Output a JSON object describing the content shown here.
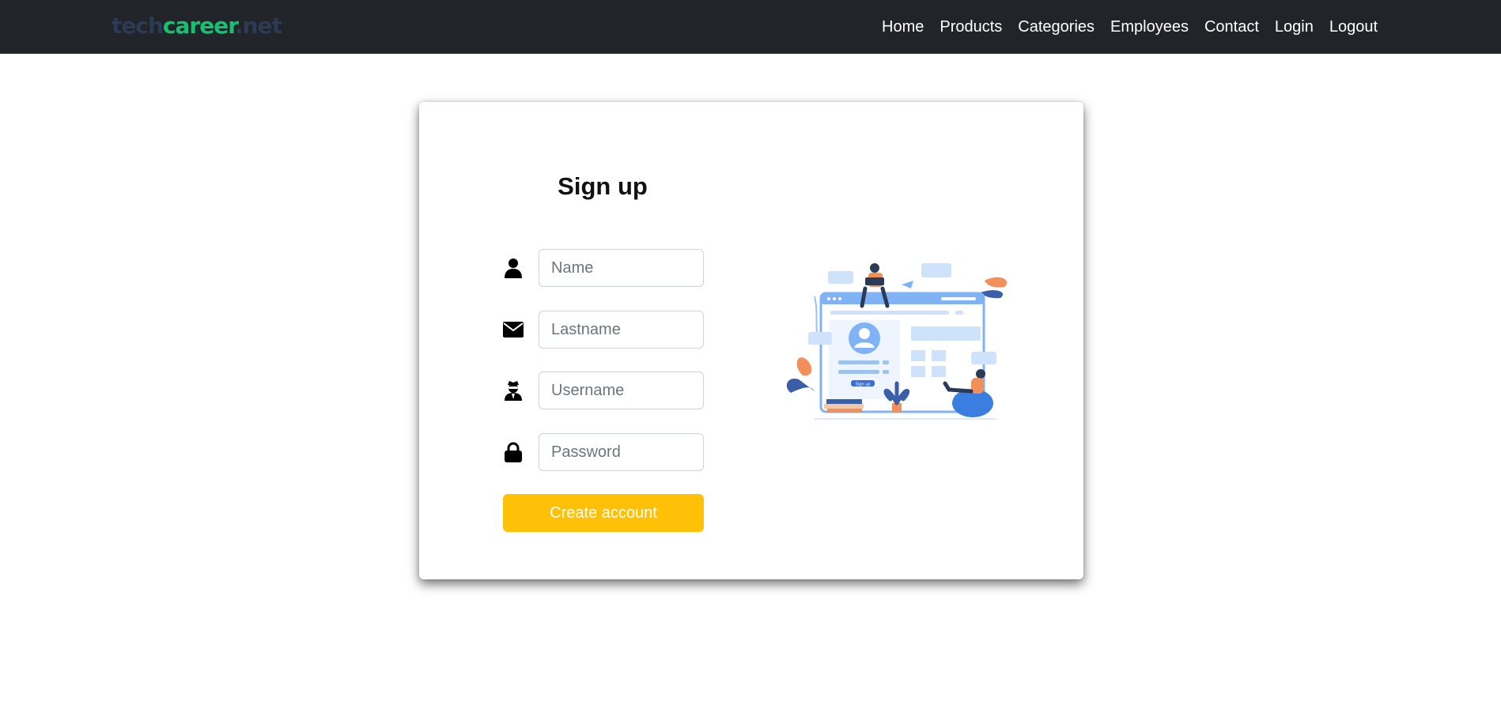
{
  "brand": {
    "part1": "tech",
    "part2": "career",
    "part3": ".net"
  },
  "nav": [
    "Home",
    "Products",
    "Categories",
    "Employees",
    "Contact",
    "Login",
    "Logout"
  ],
  "form": {
    "title": "Sign up",
    "fields": [
      {
        "icon": "person-icon",
        "placeholder": "Name",
        "value": ""
      },
      {
        "icon": "envelope-icon",
        "placeholder": "Lastname",
        "value": ""
      },
      {
        "icon": "user-secret-icon",
        "placeholder": "Username",
        "value": ""
      },
      {
        "icon": "lock-icon",
        "placeholder": "Password",
        "value": ""
      }
    ],
    "submit_label": "Create account",
    "illustration_button_label": "Sign up"
  },
  "colors": {
    "navbar_bg": "#212529",
    "brand_dark": "#2b3a55",
    "brand_green": "#16c172",
    "button_bg": "#ffc107",
    "illustration_blue": "#7fb3f5"
  }
}
